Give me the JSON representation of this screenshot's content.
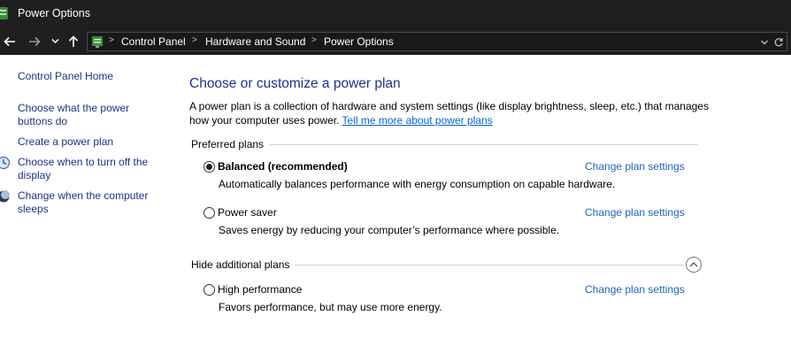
{
  "window": {
    "title": "Power Options"
  },
  "address": {
    "crumbs": [
      "Control Panel",
      "Hardware and Sound",
      "Power Options"
    ]
  },
  "sidebar": {
    "home": "Control Panel Home",
    "items": [
      {
        "label": "Choose what the power buttons do",
        "icon": ""
      },
      {
        "label": "Create a power plan",
        "icon": ""
      },
      {
        "label": "Choose when to turn off the display",
        "icon": "clock-monitor-icon"
      },
      {
        "label": "Change when the computer sleeps",
        "icon": "moon-icon"
      }
    ]
  },
  "main": {
    "title": "Choose or customize a power plan",
    "intro": "A power plan is a collection of hardware and system settings (like display brightness, sleep, etc.) that manages how your computer uses power.",
    "intro_link": "Tell me more about power plans",
    "preferred_label": "Preferred plans",
    "additional_label": "Hide additional plans",
    "change_label": "Change plan settings",
    "plans": [
      {
        "name": "Balanced (recommended)",
        "description": "Automatically balances performance with energy consumption on capable hardware.",
        "selected": true
      },
      {
        "name": "Power saver",
        "description": "Saves energy by reducing your computer’s performance where possible.",
        "selected": false
      },
      {
        "name": "High performance",
        "description": "Favors performance, but may use more energy.",
        "selected": false
      }
    ]
  }
}
